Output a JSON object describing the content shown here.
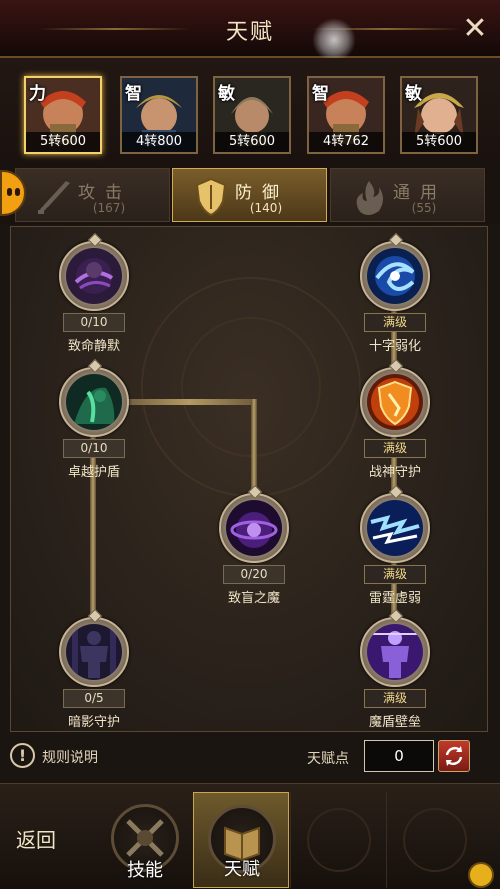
{
  "window": {
    "title": "天赋",
    "close_label": "✕"
  },
  "heroes": [
    {
      "attr": "力",
      "rank": "5转600",
      "selected": true
    },
    {
      "attr": "智",
      "rank": "4转800",
      "selected": false
    },
    {
      "attr": "敏",
      "rank": "5转600",
      "selected": false
    },
    {
      "attr": "智",
      "rank": "4转762",
      "selected": false
    },
    {
      "attr": "敏",
      "rank": "5转600",
      "selected": false
    }
  ],
  "tabs": [
    {
      "label": "攻击",
      "count": "(167)",
      "active": false
    },
    {
      "label": "防御",
      "count": "(140)",
      "active": true
    },
    {
      "label": "通用",
      "count": "(55)",
      "active": false
    }
  ],
  "talents": {
    "left": [
      {
        "level": "0/10",
        "name": "致命静默",
        "icon": "dark-vortex-icon"
      },
      {
        "level": "0/10",
        "name": "卓越护盾",
        "icon": "green-specter-icon"
      },
      {
        "level": "0/5",
        "name": "暗影守护",
        "icon": "shadow-figure-icon"
      }
    ],
    "center": [
      {
        "level": "0/20",
        "name": "致盲之魔",
        "icon": "purple-orb-icon"
      }
    ],
    "right": [
      {
        "level": "满级",
        "name": "十字弱化",
        "icon": "blue-swirl-icon"
      },
      {
        "level": "满级",
        "name": "战神守护",
        "icon": "fire-shield-icon"
      },
      {
        "level": "满级",
        "name": "雷霆虚弱",
        "icon": "lightning-icon"
      },
      {
        "level": "满级",
        "name": "魔盾壁垒",
        "icon": "arcane-figure-icon"
      }
    ]
  },
  "footer": {
    "rules_label": "规则说明",
    "points_label": "天赋点",
    "points_value": "0"
  },
  "bottom_nav": {
    "back_label": "返回",
    "skills_label": "技能",
    "talent_label": "天赋"
  },
  "colors": {
    "accent": "#d3aa52",
    "max_level": "#f1d88a",
    "selected_border": "#f2d36a"
  }
}
